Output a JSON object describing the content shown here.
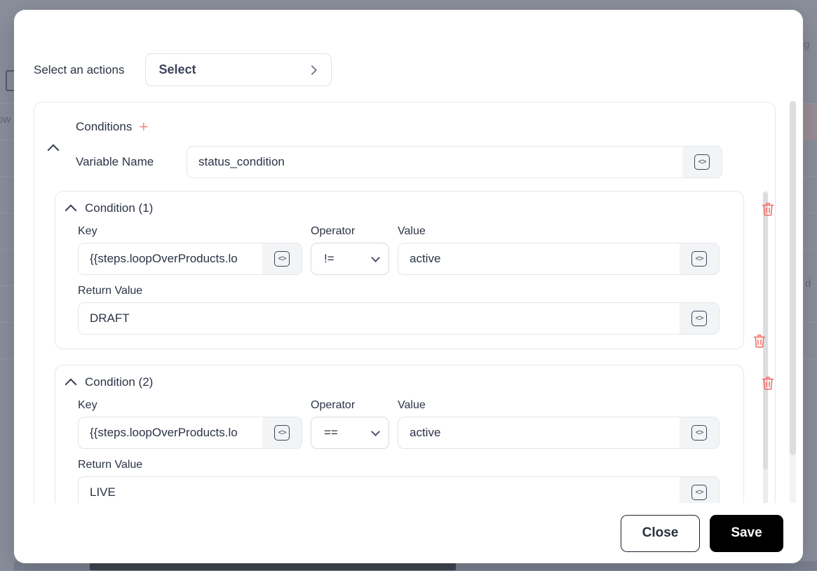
{
  "colors": {
    "accent_red": "#f08a80",
    "trash_red": "#f26a63",
    "text_primary": "#2b3345",
    "save_bg": "#000000",
    "backdrop": "#8b8f9c"
  },
  "modal": {
    "action_row": {
      "label": "Select an actions",
      "select_value": "Select",
      "chevron_icon": "chevron-right-icon"
    },
    "conditions": {
      "title": "Conditions",
      "add_icon": "plus-icon",
      "collapse_icon": "chevron-up-icon",
      "variable_name_label": "Variable Name",
      "variable_name_value": "status_condition",
      "variable_name_placeholder": "Variable Name",
      "code_icon": "code-brackets-icon",
      "items": [
        {
          "title": "Condition (1)",
          "collapse_icon": "chevron-up-icon",
          "delete_icon": "trash-icon",
          "key_label": "Key",
          "key_value": "{{steps.loopOverProducts.lo",
          "key_placeholder": "Key",
          "operator_label": "Operator",
          "operator_value": "!=",
          "operator_icon": "chevron-down-icon",
          "value_label": "Value",
          "value_value": "active",
          "value_placeholder": "Value",
          "return_label": "Return Value",
          "return_value": "DRAFT",
          "return_placeholder": "Return Value"
        },
        {
          "title": "Condition (2)",
          "collapse_icon": "chevron-up-icon",
          "delete_icon": "trash-icon",
          "key_label": "Key",
          "key_value": "{{steps.loopOverProducts.lo",
          "key_placeholder": "Key",
          "operator_label": "Operator",
          "operator_value": "==",
          "operator_icon": "chevron-down-icon",
          "value_label": "Value",
          "value_value": "active",
          "value_placeholder": "Value",
          "return_label": "Return Value",
          "return_value": "LIVE",
          "return_placeholder": "Return Value"
        }
      ],
      "outer_delete_icon": "trash-icon"
    },
    "footer": {
      "close_label": "Close",
      "save_label": "Save"
    }
  }
}
